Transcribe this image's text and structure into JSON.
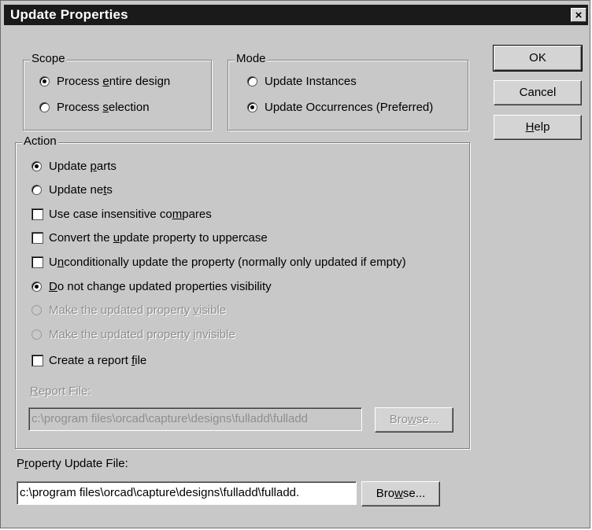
{
  "window": {
    "title": "Update Properties",
    "close_glyph": "×"
  },
  "scope": {
    "legend": "Scope",
    "options": [
      {
        "label": "Process entire design",
        "selected": true
      },
      {
        "label": "Process selection",
        "selected": false
      }
    ]
  },
  "mode": {
    "legend": "Mode",
    "options": [
      {
        "label": "Update Instances",
        "selected": false
      },
      {
        "label": "Update Occurrences (Preferred)",
        "selected": true
      }
    ]
  },
  "buttons": {
    "ok": "OK",
    "cancel": "Cancel",
    "help": "Help"
  },
  "action": {
    "legend": "Action",
    "update_parts": "Update parts",
    "update_nets": "Update nets",
    "case_insensitive": "Use case insensitive compares",
    "convert_uppercase": "Convert the update property to uppercase",
    "unconditional": "Unconditionally update the property (normally only updated if empty)",
    "no_change_visibility": "Do not change updated properties visibility",
    "make_visible": "Make the updated property visible",
    "make_invisible": "Make the updated property invisible",
    "create_report": "Create a report file",
    "report_file_label": "Report File:",
    "report_file_value": "c:\\program files\\orcad\\capture\\designs\\fulladd\\fulladd",
    "report_browse": "Browse..."
  },
  "property_update": {
    "label": "Property Update File:",
    "value": "c:\\program files\\orcad\\capture\\designs\\fulladd\\fulladd.",
    "browse": "Browse..."
  },
  "icons": {
    "radio": "radio-button",
    "checkbox": "checkbox",
    "close": "close-icon"
  }
}
